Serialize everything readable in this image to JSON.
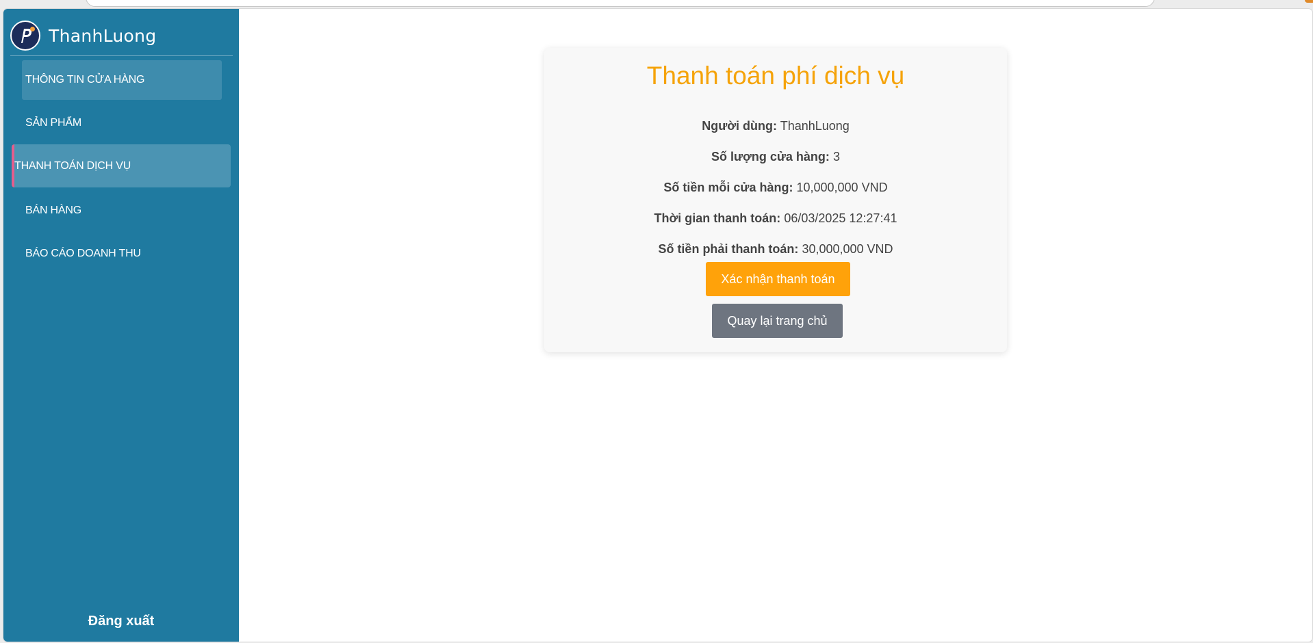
{
  "colors": {
    "sidebar": "#1f7aa0",
    "title": "#f5a30a",
    "confirm_button": "#ffa20a",
    "back_button": "#6e7580",
    "active_indicator": "#e45e8d"
  },
  "sidebar": {
    "brand": "ThanhLuong",
    "logo_icon": "p-logo-icon",
    "items": [
      {
        "label": "THÔNG TIN CỬA HÀNG"
      },
      {
        "label": "SẢN PHẨM"
      },
      {
        "label": "THANH TOÁN DỊCH VỤ"
      },
      {
        "label": "BÁN HÀNG"
      },
      {
        "label": "BÁO CÁO DOANH THU"
      }
    ],
    "logout": "Đăng xuất"
  },
  "payment": {
    "title": "Thanh toán phí dịch vụ",
    "rows": [
      {
        "label": "Người dùng:",
        "value": "ThanhLuong"
      },
      {
        "label": "Số lượng cửa hàng:",
        "value": "3"
      },
      {
        "label": "Số tiền mỗi cửa hàng:",
        "value": "10,000,000 VND"
      },
      {
        "label": "Thời gian thanh toán:",
        "value": "06/03/2025 12:27:41"
      },
      {
        "label": "Số tiền phải thanh toán:",
        "value": "30,000,000 VND"
      }
    ],
    "confirm_label": "Xác nhận thanh toán",
    "back_label": "Quay lại trang chủ"
  }
}
